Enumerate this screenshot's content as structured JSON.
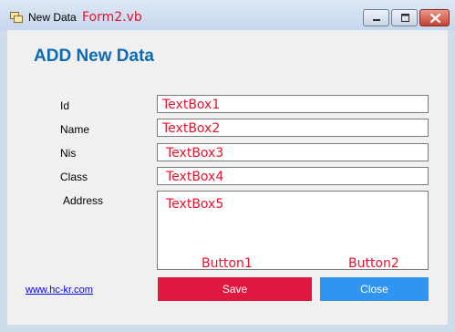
{
  "window": {
    "title": "New Data",
    "title_annotation": "Form2.vb",
    "controls": {
      "minimize": "minimize-icon",
      "maximize": "maximize-icon",
      "close": "close-icon"
    }
  },
  "form": {
    "heading": "ADD New Data",
    "fields": [
      {
        "label": "Id",
        "annotation": "TextBox1",
        "value": ""
      },
      {
        "label": "Name",
        "annotation": "TextBox2",
        "value": ""
      },
      {
        "label": "Nis",
        "annotation": "TextBox3",
        "value": ""
      },
      {
        "label": "Class",
        "annotation": "TextBox4",
        "value": ""
      },
      {
        "label": "Address",
        "annotation": "TextBox5",
        "value": ""
      }
    ],
    "link": "www.hc-kr.com",
    "buttons": {
      "save": {
        "label": "Save",
        "annotation": "Button1",
        "color": "#e0173e"
      },
      "close": {
        "label": "Close",
        "annotation": "Button2",
        "color": "#2f95f0"
      }
    }
  },
  "colors": {
    "heading": "#0d6bb3",
    "annotation": "#e8112d",
    "link": "#0000ee"
  }
}
